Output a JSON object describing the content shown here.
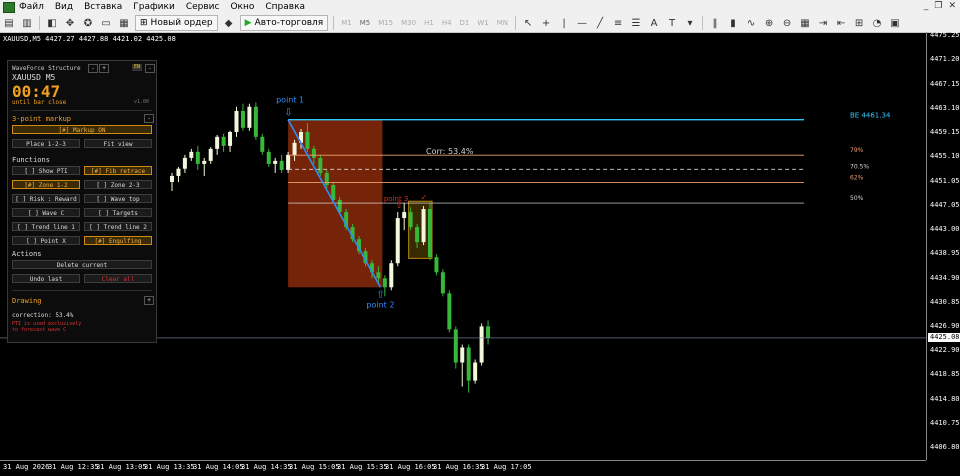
{
  "menu": {
    "items": [
      "Файл",
      "Вид",
      "Вставка",
      "Графики",
      "Сервис",
      "Окно",
      "Справка"
    ]
  },
  "toolbar": {
    "new_order": "Новый ордер",
    "auto_trading": "Авто-торговля",
    "timeframes": [
      "M1",
      "M5",
      "M15",
      "M30",
      "H1",
      "H4",
      "D1",
      "W1",
      "MN"
    ]
  },
  "chart": {
    "header": "XAUUSD,M5  4427.27 4427.88 4421.02 4425.08",
    "current_price": "4425.08",
    "price_labels": [
      "4475.25",
      "4471.20",
      "4467.15",
      "4463.10",
      "4459.15",
      "4455.10",
      "4451.05",
      "4447.05",
      "4443.00",
      "4438.95",
      "4434.90",
      "4430.85",
      "4426.90",
      "4422.90",
      "4418.85",
      "4414.80",
      "4410.75",
      "4406.80"
    ],
    "time_labels": [
      "31 Aug 2026",
      "31 Aug 12:35",
      "31 Aug 13:05",
      "31 Aug 13:35",
      "31 Aug 14:05",
      "31 Aug 14:35",
      "31 Aug 15:05",
      "31 Aug 15:35",
      "31 Aug 16:05",
      "31 Aug 16:35",
      "31 Aug 17:05"
    ],
    "point1": "point 1",
    "point2": "point 2",
    "point3": "point 3",
    "be_label": "BE  4461.34",
    "corr_label": "Corr: 53.4%",
    "fib_79": "79%",
    "fib_705": "70.5%",
    "fib_62": "62%",
    "fib_50": "50%",
    "colors": {
      "bull": "#f4f7dc",
      "bear": "#38b838",
      "zone": "#8b2a0a",
      "trend": "#2f8df5",
      "be": "#2ec8ff",
      "fib": "#f0a070",
      "mid": "#f0f0f0"
    },
    "candles": [
      [
        4451.0,
        4452.5,
        4449.5,
        4452.0
      ],
      [
        4452.0,
        4453.5,
        4451.0,
        4453.2
      ],
      [
        4453.2,
        4455.5,
        4452.5,
        4455.0
      ],
      [
        4455.0,
        4456.5,
        4454.5,
        4456.0
      ],
      [
        4456.0,
        4457.0,
        4453.0,
        4454.0
      ],
      [
        4454.0,
        4455.0,
        4452.0,
        4454.5
      ],
      [
        4454.5,
        4456.8,
        4454.0,
        4456.5
      ],
      [
        4456.5,
        4458.8,
        4455.5,
        4458.5
      ],
      [
        4458.5,
        4459.0,
        4456.0,
        4457.0
      ],
      [
        4457.0,
        4459.5,
        4456.0,
        4459.3
      ],
      [
        4459.3,
        4463.5,
        4458.5,
        4462.8
      ],
      [
        4462.8,
        4464.0,
        4459.5,
        4460.0
      ],
      [
        4460.0,
        4464.0,
        4459.5,
        4463.5
      ],
      [
        4463.5,
        4464.2,
        4458.0,
        4458.5
      ],
      [
        4458.5,
        4459.0,
        4455.5,
        4456.0
      ],
      [
        4456.0,
        4456.5,
        4453.5,
        4454.0
      ],
      [
        4454.0,
        4455.0,
        4452.5,
        4454.5
      ],
      [
        4454.5,
        4455.5,
        4452.5,
        4453.0
      ],
      [
        4453.0,
        4456.0,
        4452.5,
        4455.5
      ],
      [
        4455.5,
        4458.0,
        4454.5,
        4457.5
      ],
      [
        4457.5,
        4459.8,
        4456.5,
        4459.3
      ],
      [
        4459.3,
        4460.8,
        4456.0,
        4456.5
      ],
      [
        4456.5,
        4457.0,
        4454.0,
        4455.0
      ],
      [
        4455.0,
        4455.5,
        4452.0,
        4452.5
      ],
      [
        4452.5,
        4453.0,
        4450.0,
        4450.5
      ],
      [
        4450.5,
        4451.0,
        4447.5,
        4448.0
      ],
      [
        4448.0,
        4448.5,
        4445.5,
        4446.0
      ],
      [
        4446.0,
        4446.5,
        4443.0,
        4443.5
      ],
      [
        4443.5,
        4444.0,
        4441.0,
        4441.5
      ],
      [
        4441.5,
        4442.0,
        4439.0,
        4439.5
      ],
      [
        4439.5,
        4440.0,
        4437.0,
        4437.5
      ],
      [
        4437.5,
        4438.0,
        4435.0,
        4436.0
      ],
      [
        4436.0,
        4437.0,
        4434.0,
        4435.0
      ],
      [
        4435.0,
        4435.5,
        4432.0,
        4433.5
      ],
      [
        4433.5,
        4438.0,
        4433.0,
        4437.5
      ],
      [
        4437.5,
        4446.0,
        4437.0,
        4445.0
      ],
      [
        4445.0,
        4447.5,
        4443.0,
        4446.0
      ],
      [
        4446.0,
        4446.8,
        4443.0,
        4443.5
      ],
      [
        4443.5,
        4444.0,
        4440.0,
        4441.0
      ],
      [
        4441.0,
        4447.0,
        4440.5,
        4446.5
      ],
      [
        4446.5,
        4447.5,
        4438.0,
        4438.5
      ],
      [
        4438.5,
        4439.0,
        4435.5,
        4436.0
      ],
      [
        4436.0,
        4436.5,
        4432.0,
        4432.5
      ],
      [
        4432.5,
        4433.0,
        4426.0,
        4426.5
      ],
      [
        4426.5,
        4427.0,
        4420.0,
        4421.0
      ],
      [
        4421.0,
        4424.0,
        4417.0,
        4423.5
      ],
      [
        4423.5,
        4424.0,
        4416.0,
        4418.0
      ],
      [
        4418.0,
        4421.5,
        4417.5,
        4421.0
      ],
      [
        4421.0,
        4427.5,
        4420.5,
        4427.0
      ],
      [
        4427.0,
        4428.0,
        4424.0,
        4425.08
      ]
    ]
  },
  "panel": {
    "title": "WaveForce Structure",
    "minus": "-",
    "plus": "+",
    "lang": "EN",
    "close": "-",
    "symbol": "XAUUSD  M5",
    "timer": "00:47",
    "until": "until bar close",
    "version": "v1.00",
    "section_markup": "3-point markup",
    "markup_minus": "-",
    "markup_on": "[#] Markup ON",
    "place": "Place 1-2-3",
    "fit": "Fit view",
    "section_functions": "Functions",
    "btn_pti": "[ ] Show PTI",
    "btn_fib": "[#] Fib retrace",
    "btn_zone12": "[#] Zone 1-2",
    "btn_zone23": "[ ] Zone 2-3",
    "btn_risk": "[ ] Risk : Reward",
    "btn_wavetop": "[ ] Wave top",
    "btn_wavec": "[ ] Wave C",
    "btn_targets": "[ ] Targets",
    "btn_trend1": "[ ] Trend line 1",
    "btn_trend2": "[ ] Trend line 2",
    "btn_pointx": "[ ] Point X",
    "btn_engulf": "[#] Engulfing",
    "section_actions": "Actions",
    "delete": "Delete current",
    "undo": "Undo last",
    "clear": "Clear all",
    "section_drawing": "Drawing",
    "drawing_plus": "+",
    "correction": "correction: 53.4%",
    "warn1": "PTI is used exclusively",
    "warn2": "to forecast wave C"
  }
}
